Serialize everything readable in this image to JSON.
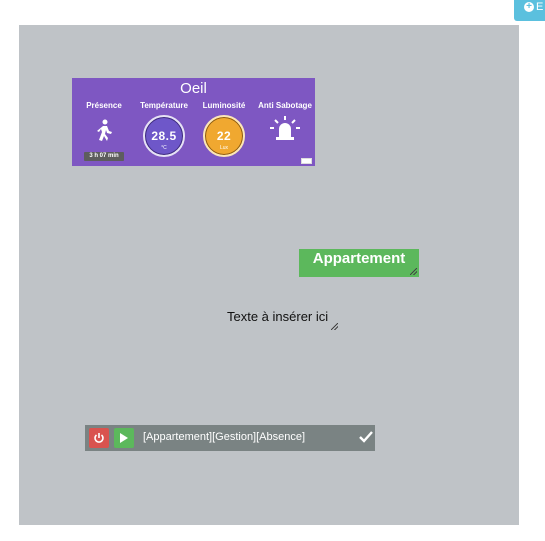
{
  "toolbar": {
    "add_label": "E"
  },
  "eye_widget": {
    "title": "Oeil",
    "presence": {
      "label": "Présence",
      "time": "3 h 07 min",
      "icon": "walking-person-icon"
    },
    "temperature": {
      "label": "Température",
      "value": "28.5",
      "unit": "°C"
    },
    "luminosity": {
      "label": "Luminosité",
      "value": "22",
      "unit": "Lux"
    },
    "tamper": {
      "label": "Anti Sabotage",
      "icon": "siren-icon"
    },
    "colors": {
      "background": "#7e57c2",
      "temp_gauge": "#6e57c9",
      "lum_gauge": "#f0a830"
    }
  },
  "apartment_label": "Appartement",
  "text_placeholder": "Texte à insérer ici",
  "scenario": {
    "text": "[Appartement][Gestion][Absence]",
    "power_icon": "power-icon",
    "play_icon": "play-icon",
    "check_icon": "check-icon"
  },
  "colors": {
    "canvas": "#bfc3c7",
    "green": "#5cb85c",
    "red": "#d9534f",
    "info": "#5bc0de"
  }
}
